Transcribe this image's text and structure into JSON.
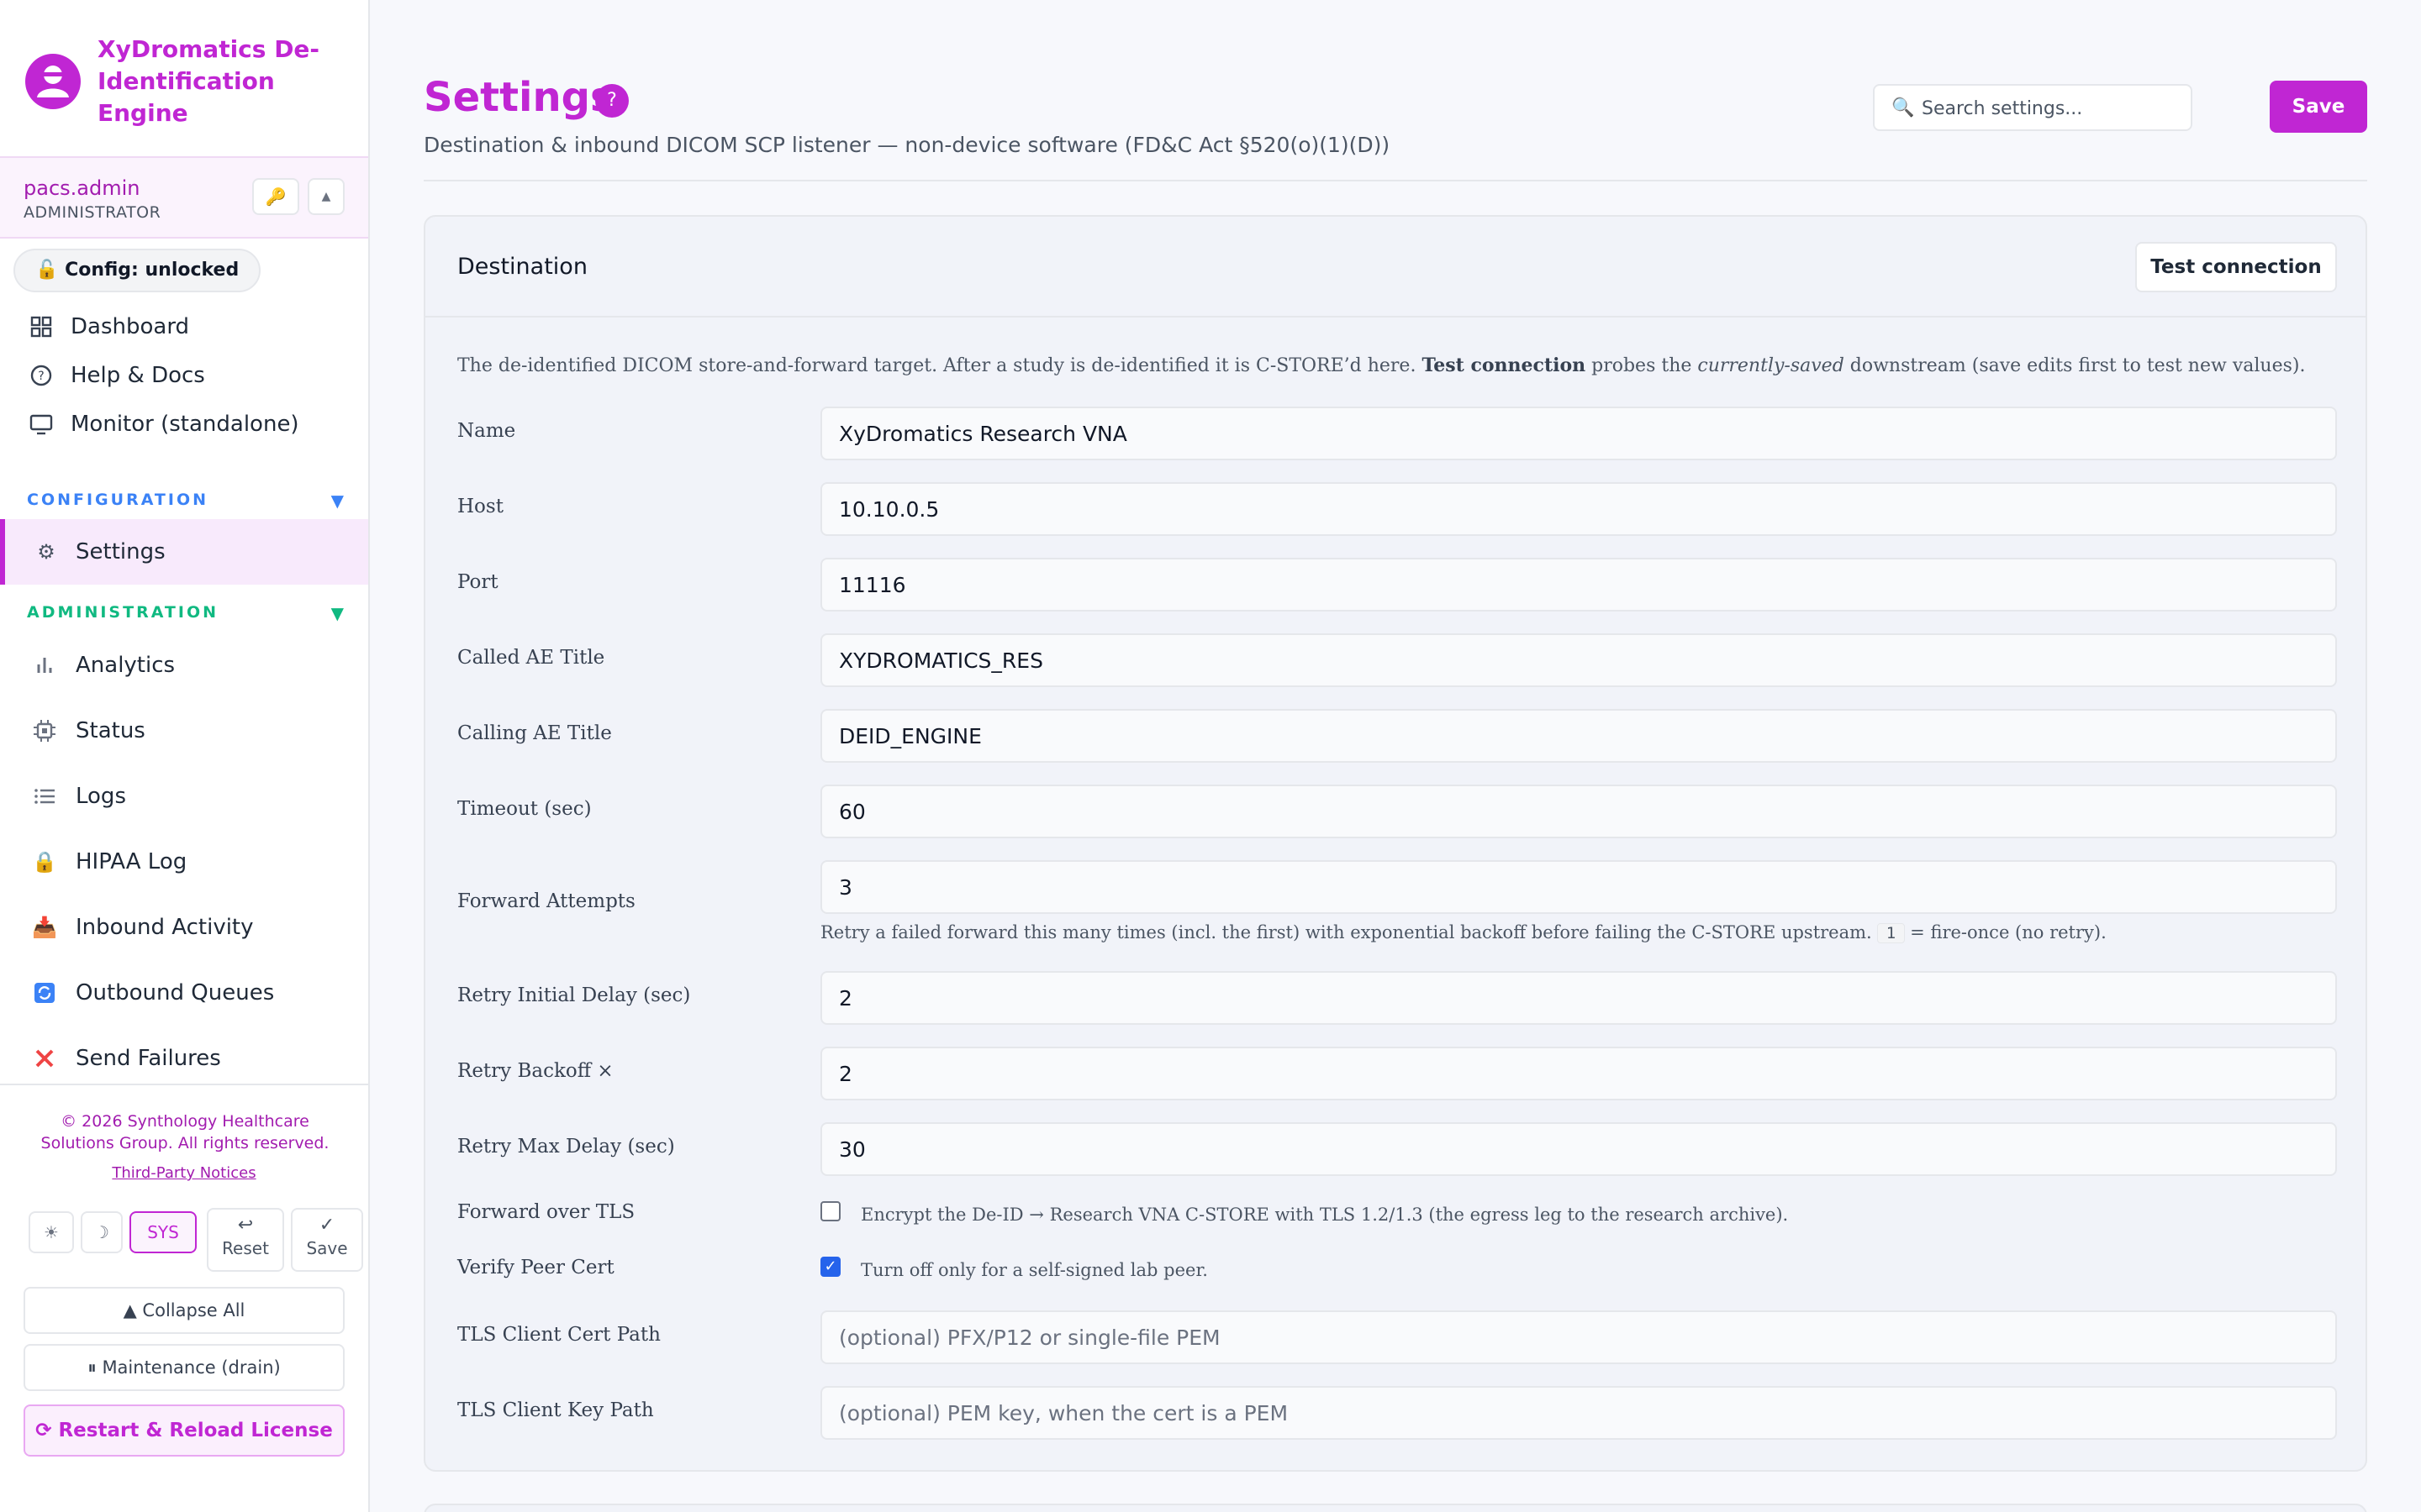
{
  "brand": {
    "title": "XyDromatics De-Identification Engine"
  },
  "user": {
    "name": "pacs.admin",
    "role": "ADMINISTRATOR"
  },
  "config_pill": "Config: unlocked",
  "nav_top": [
    {
      "label": "Dashboard",
      "icon": "grid-icon"
    },
    {
      "label": "Help & Docs",
      "icon": "help-circle-icon"
    },
    {
      "label": "Monitor (standalone)",
      "icon": "monitor-icon"
    }
  ],
  "sections": {
    "configuration": "CONFIGURATION",
    "administration": "ADMINISTRATION"
  },
  "nav_config": [
    {
      "label": "Settings",
      "icon": "gear-icon"
    }
  ],
  "nav_admin": [
    {
      "label": "Analytics",
      "icon": "bar-chart-icon"
    },
    {
      "label": "Status",
      "icon": "chip-icon"
    },
    {
      "label": "Logs",
      "icon": "list-icon"
    },
    {
      "label": "HIPAA Log",
      "icon": "lock-icon"
    },
    {
      "label": "Inbound Activity",
      "icon": "inbox-icon"
    },
    {
      "label": "Outbound Queues",
      "icon": "refresh-icon"
    },
    {
      "label": "Send Failures",
      "icon": "x-icon"
    }
  ],
  "footer": {
    "copyright": "© 2026 Synthology Healthcare Solutions Group. All rights reserved.",
    "notices": "Third-Party Notices",
    "theme_light": "☀",
    "theme_dark": "☽",
    "theme_sys": "SYS",
    "reset_icon": "↩",
    "reset": "Reset",
    "save_icon": "✓",
    "save": "Save",
    "collapse_all": "▲ Collapse All",
    "maintenance": "⏸ Maintenance (drain)",
    "restart": "⟳ Restart & Reload License"
  },
  "page": {
    "title": "Settings",
    "help": "?",
    "subtitle": "Destination & inbound DICOM SCP listener — non-device software (FD&C Act §520(o)(1)(D))",
    "search_placeholder": "Search settings...",
    "save": "Save"
  },
  "card": {
    "title": "Destination",
    "test_button": "Test connection",
    "desc_pre": "The de-identified DICOM store-and-forward target. After a study is de-identified it is C-STORE’d here. ",
    "desc_bold": "Test connection",
    "desc_mid": " probes the ",
    "desc_italic": "currently-saved",
    "desc_post": " downstream (save edits first to test new values)."
  },
  "fields": {
    "name": {
      "label": "Name",
      "value": "XyDromatics Research VNA"
    },
    "host": {
      "label": "Host",
      "value": "10.10.0.5"
    },
    "port": {
      "label": "Port",
      "value": "11116"
    },
    "called_ae": {
      "label": "Called AE Title",
      "value": "XYDROMATICS_RES"
    },
    "calling_ae": {
      "label": "Calling AE Title",
      "value": "DEID_ENGINE"
    },
    "timeout": {
      "label": "Timeout (sec)",
      "value": "60"
    },
    "forward_attempts": {
      "label": "Forward Attempts",
      "value": "3",
      "hint_pre": "Retry a failed forward this many times (incl. the first) with exponential backoff before failing the C-STORE upstream.",
      "hint_code": "1",
      "hint_post": "= fire-once (no retry)."
    },
    "retry_initial": {
      "label": "Retry Initial Delay (sec)",
      "value": "2"
    },
    "retry_backoff": {
      "label": "Retry Backoff ×",
      "value": "2"
    },
    "retry_max": {
      "label": "Retry Max Delay (sec)",
      "value": "30"
    },
    "forward_tls": {
      "label": "Forward over TLS",
      "checked": false,
      "text": "Encrypt the De-ID → Research VNA C-STORE with TLS 1.2/1.3 (the egress leg to the research archive)."
    },
    "verify_peer": {
      "label": "Verify Peer Cert",
      "checked": true,
      "text": "Turn off only for a self-signed lab peer."
    },
    "tls_cert": {
      "label": "TLS Client Cert Path",
      "placeholder": "(optional) PFX/P12 or single-file PEM"
    },
    "tls_key": {
      "label": "TLS Client Key Path",
      "placeholder": "(optional) PEM key, when the cert is a PEM"
    }
  },
  "colors": {
    "accent": "#c026d3",
    "config_section": "#3b82f6",
    "admin_section": "#10b981",
    "checkbox": "#2563eb"
  }
}
